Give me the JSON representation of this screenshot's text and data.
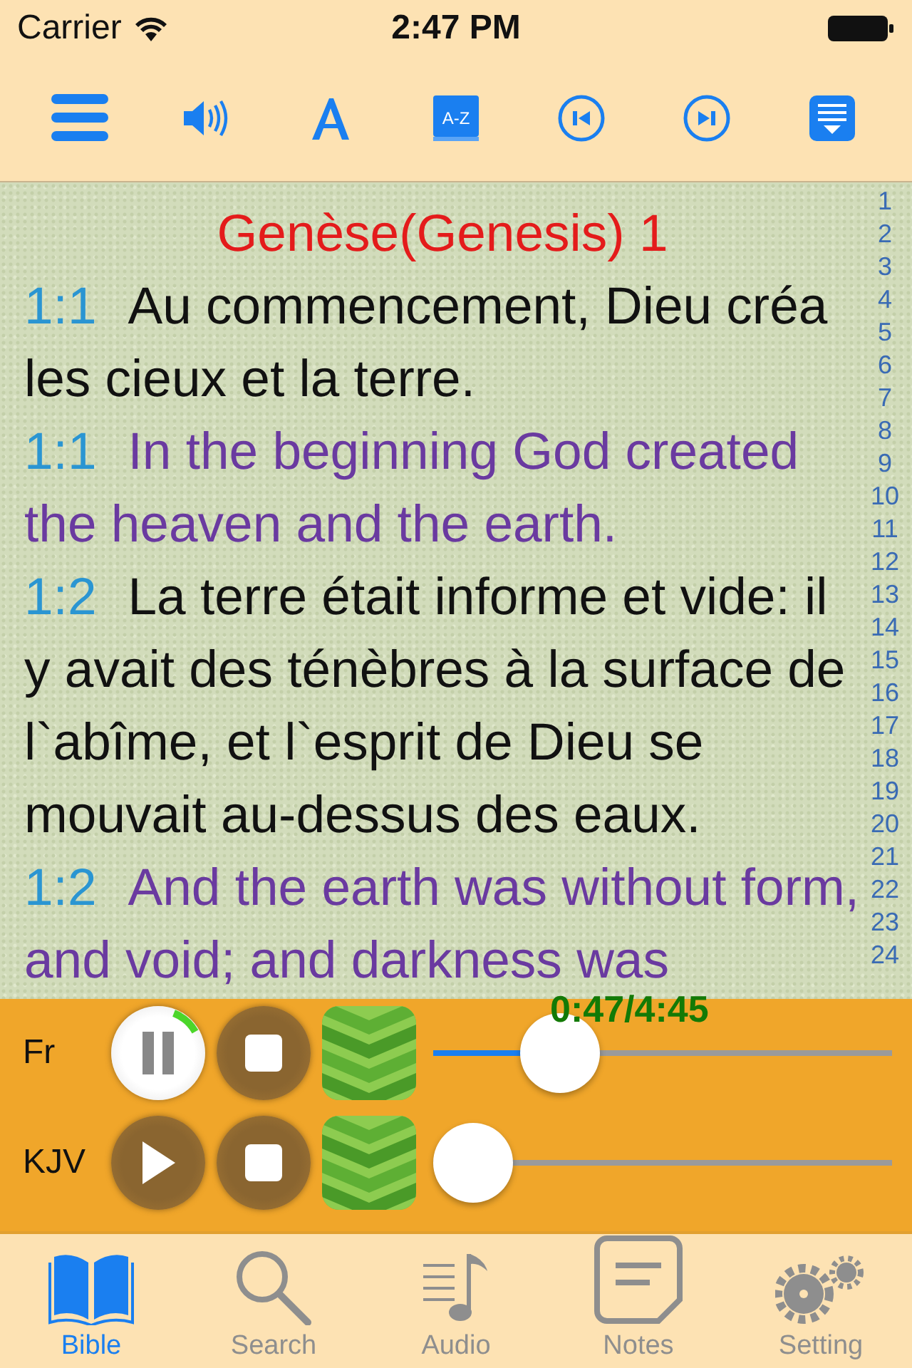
{
  "status_bar": {
    "carrier": "Carrier",
    "time": "2:47 PM"
  },
  "toolbar": {
    "buttons": [
      {
        "kind": "menu"
      },
      {
        "kind": "speaker"
      },
      {
        "kind": "font"
      },
      {
        "kind": "dictionary",
        "label": "A-Z"
      },
      {
        "kind": "previous"
      },
      {
        "kind": "next"
      },
      {
        "kind": "download"
      }
    ]
  },
  "chapter": {
    "title": "Genèse(Genesis) 1",
    "verses": [
      {
        "ref": "1:1",
        "kind": "original",
        "text": "Au commencement, Dieu créa les cieux et la terre."
      },
      {
        "ref": "1:1",
        "kind": "translation",
        "text": "In the beginning God created the heaven and the earth."
      },
      {
        "ref": "1:2",
        "kind": "original",
        "text": "La terre était informe et vide: il y avait des ténèbres à la surface de l`abîme, et l`esprit de Dieu se mouvait au-dessus des eaux."
      },
      {
        "ref": "1:2",
        "kind": "translation",
        "text": "And the earth was without form, and void; and darkness was"
      }
    ],
    "verse_index": [
      "1",
      "2",
      "3",
      "4",
      "5",
      "6",
      "7",
      "8",
      "9",
      "10",
      "11",
      "12",
      "13",
      "14",
      "15",
      "16",
      "17",
      "18",
      "19",
      "20",
      "21",
      "22",
      "23",
      "24"
    ]
  },
  "player": {
    "tracks": [
      {
        "label": "Fr",
        "playing": true,
        "level": 0.23,
        "time": "0:47/4:45"
      },
      {
        "label": "KJV",
        "playing": false,
        "level": 0
      }
    ]
  },
  "tab_bar": [
    {
      "label": "Bible",
      "kind": "book",
      "selected": true
    },
    {
      "label": "Search",
      "kind": "search",
      "selected": false
    },
    {
      "label": "Audio",
      "kind": "audio",
      "selected": false
    },
    {
      "label": "Notes",
      "kind": "notes",
      "selected": false
    },
    {
      "label": "Setting",
      "kind": "settings",
      "selected": false
    }
  ]
}
